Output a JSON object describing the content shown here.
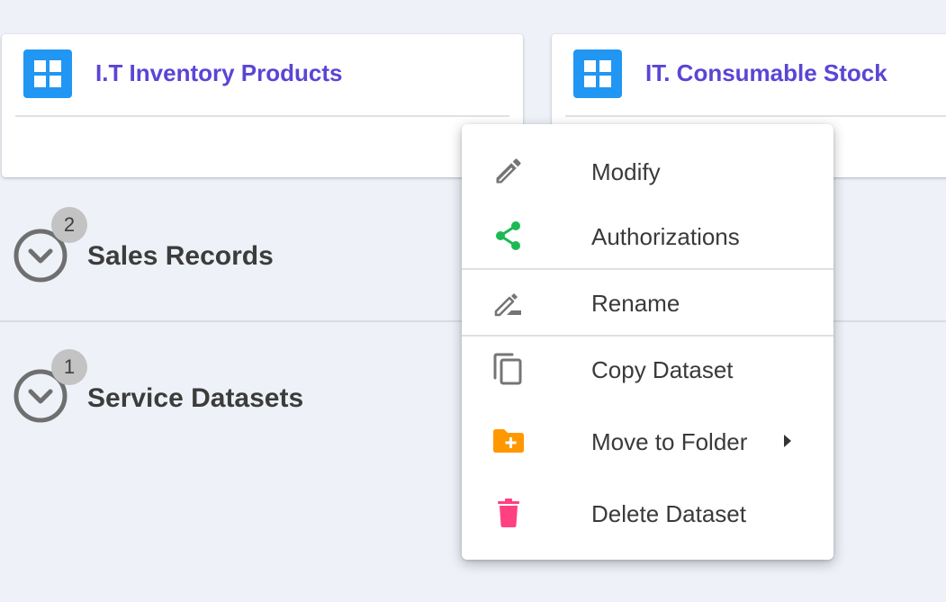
{
  "cards": [
    {
      "title": "I.T Inventory Products",
      "icon": "grid-icon"
    },
    {
      "title": "IT. Consumable Stock",
      "icon": "grid-icon"
    }
  ],
  "folders": [
    {
      "title": "Sales Records",
      "count": "2",
      "icon": "chevron-down-circle-icon"
    },
    {
      "title": "Service Datasets",
      "count": "1",
      "icon": "chevron-down-circle-icon"
    }
  ],
  "context_menu": {
    "items": [
      {
        "label": "Modify",
        "icon": "pencil-icon"
      },
      {
        "label": "Authorizations",
        "icon": "share-icon"
      },
      {
        "label": "Rename",
        "icon": "rename-icon"
      },
      {
        "label": "Copy Dataset",
        "icon": "copy-icon"
      },
      {
        "label": "Move to Folder",
        "icon": "folder-plus-icon"
      },
      {
        "label": "Delete Dataset",
        "icon": "trash-icon"
      }
    ]
  },
  "colors": {
    "background": "#eef1f8",
    "card_title": "#5a45d6",
    "grid_icon": "#2196f3",
    "share_icon": "#1db954",
    "folder_icon": "#ff9800",
    "trash_icon": "#ff4081",
    "badge": "#c3c3c3"
  }
}
